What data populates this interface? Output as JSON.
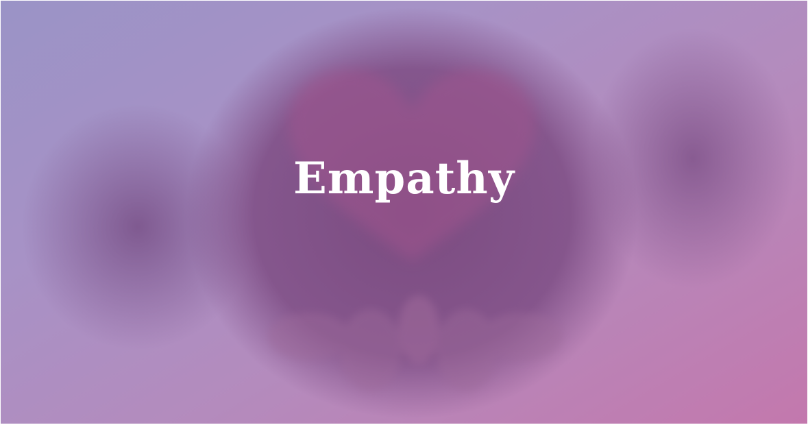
{
  "image": {
    "title": "Empathy",
    "colors": {
      "background_top_left": "#9a93c6",
      "background_bottom_right": "#c378ad",
      "center_circle": "#7a4a7d",
      "title_text": "#ffffff"
    }
  }
}
